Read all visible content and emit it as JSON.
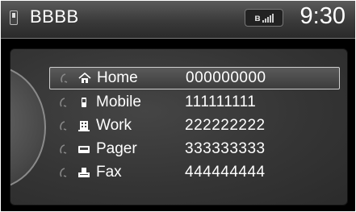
{
  "header": {
    "title": "BBBB",
    "time": "9:30",
    "phone_icon": "phone-icon",
    "bluetooth_icon": "bluetooth-icon",
    "signal_icon": "signal-strength-icon"
  },
  "numbers": [
    {
      "icon": "home-icon",
      "label": "Home",
      "number": "000000000",
      "selected": true
    },
    {
      "icon": "mobile-icon",
      "label": "Mobile",
      "number": "111111111",
      "selected": false
    },
    {
      "icon": "work-icon",
      "label": "Work",
      "number": "222222222",
      "selected": false
    },
    {
      "icon": "pager-icon",
      "label": "Pager",
      "number": "333333333",
      "selected": false
    },
    {
      "icon": "fax-icon",
      "label": "Fax",
      "number": "444444444",
      "selected": false
    }
  ]
}
